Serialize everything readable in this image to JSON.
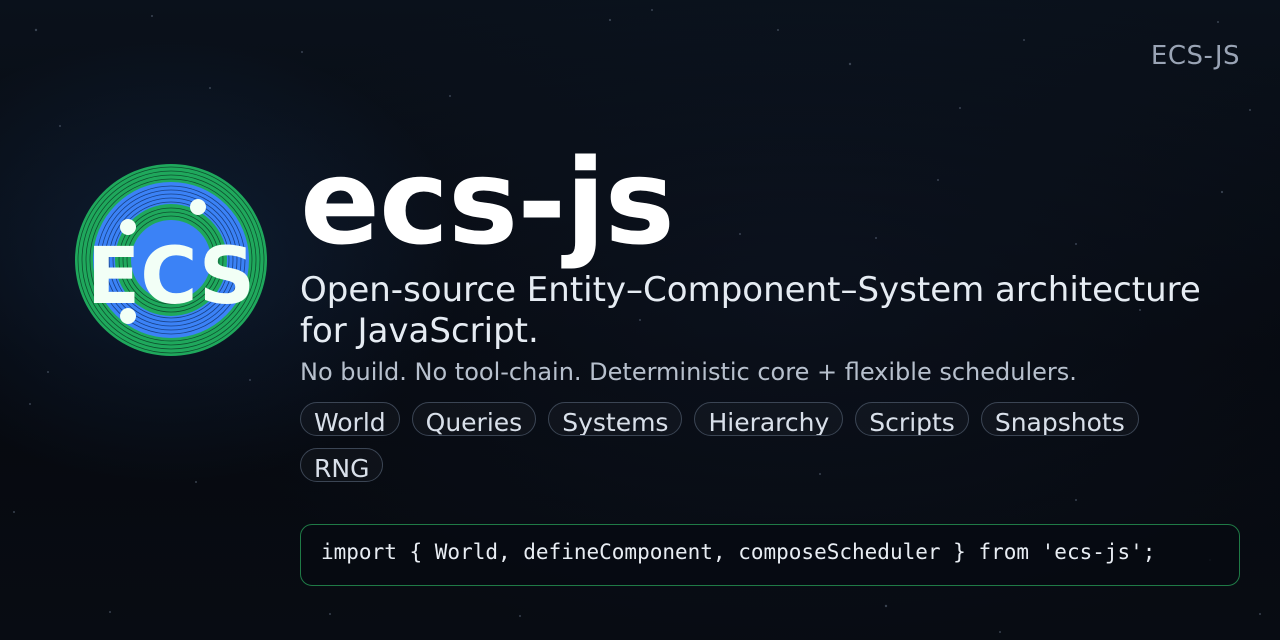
{
  "corner_brand": "ECS-JS",
  "logo": {
    "text": "ECS",
    "colors": {
      "outer_ring": "#2ecc71",
      "inner_ring": "#3b82f6",
      "text": "#f2fff6"
    }
  },
  "title": "ecs-js",
  "subtitle": "Open-source Entity–Component–System architecture for JavaScript.",
  "tagline": "No build. No tool-chain. Deterministic core + flexible schedulers.",
  "chips": [
    "World",
    "Queries",
    "Systems",
    "Hierarchy",
    "Scripts",
    "Snapshots",
    "RNG"
  ],
  "code": "import { World, defineComponent, composeScheduler } from 'ecs-js';",
  "colors": {
    "background": "#070b12",
    "code_border": "#1f7a46",
    "chip_border": "#3b4554"
  }
}
